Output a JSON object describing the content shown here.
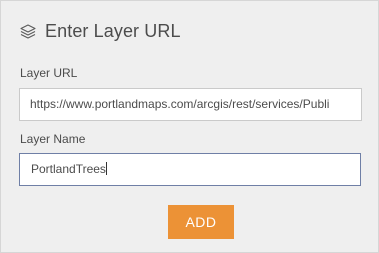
{
  "header": {
    "title": "Enter Layer URL",
    "icon": "layers-icon"
  },
  "form": {
    "url_label": "Layer URL",
    "url_value": "https://www.portlandmaps.com/arcgis/rest/services/Publi",
    "name_label": "Layer Name",
    "name_value": "PortlandTrees"
  },
  "actions": {
    "add_label": "ADD"
  },
  "colors": {
    "accent": "#ec9236",
    "background": "#efefef",
    "focus_border": "#6f7fa6"
  }
}
